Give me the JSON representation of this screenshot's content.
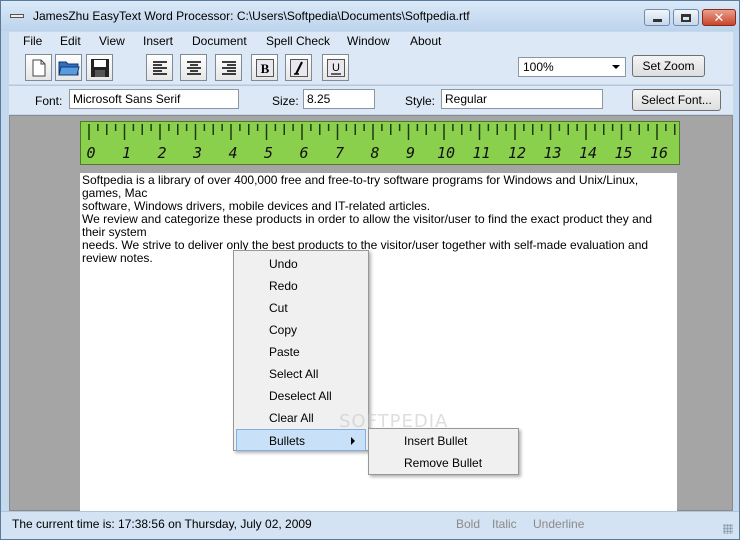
{
  "window": {
    "title": "JamesZhu EasyText Word Processor: C:\\Users\\Softpedia\\Documents\\Softpedia.rtf"
  },
  "menu": [
    "File",
    "Edit",
    "View",
    "Insert",
    "Document",
    "Spell Check",
    "Window",
    "About"
  ],
  "toolbar": {
    "buttons": [
      "new-file-icon",
      "open-folder-icon",
      "save-disk-icon",
      "align-left-icon",
      "align-center-icon",
      "align-right-icon",
      "bold-icon",
      "italic-icon",
      "underline-icon"
    ],
    "zoom_value": "100%",
    "set_zoom_label": "Set Zoom"
  },
  "fontbar": {
    "font_label": "Font:",
    "font_value": "Microsoft Sans Serif",
    "size_label": "Size:",
    "size_value": "8.25",
    "style_label": "Style:",
    "style_value": "Regular",
    "select_font_label": "Select Font..."
  },
  "ruler": {
    "numbers": [
      "0",
      "1",
      "2",
      "3",
      "4",
      "5",
      "6",
      "7",
      "8",
      "9",
      "10",
      "11",
      "12",
      "13",
      "14",
      "15",
      "16"
    ]
  },
  "document": {
    "para1": "Softpedia is a library of over 400,000 free and free-to-try software programs for Windows and Unix/Linux, games, Mac\nsoftware, Windows drivers, mobile devices and IT-related articles.",
    "para2": "We review and categorize these products in order to allow the visitor/user to find the exact product they and their system\nneeds. We strive to deliver only the best products to the visitor/user together with self-made evaluation and review notes."
  },
  "context_menu": {
    "items": [
      "Undo",
      "Redo",
      "Cut",
      "Copy",
      "Paste",
      "Select All",
      "Deselect All",
      "Clear All",
      "Bullets"
    ],
    "highlighted": "Bullets"
  },
  "submenu": {
    "items": [
      "Insert Bullet",
      "Remove Bullet"
    ]
  },
  "watermark": "SOFTPEDIA",
  "status": {
    "time_text": "The current time is: 17:38:56 on Thursday, July 02, 2009",
    "bold": "Bold",
    "italic": "Italic",
    "underline": "Underline"
  },
  "colors": {
    "ruler_green": "#8bd04d",
    "highlight": "#c8e0f8",
    "status_disabled": "#8a8a8a"
  }
}
